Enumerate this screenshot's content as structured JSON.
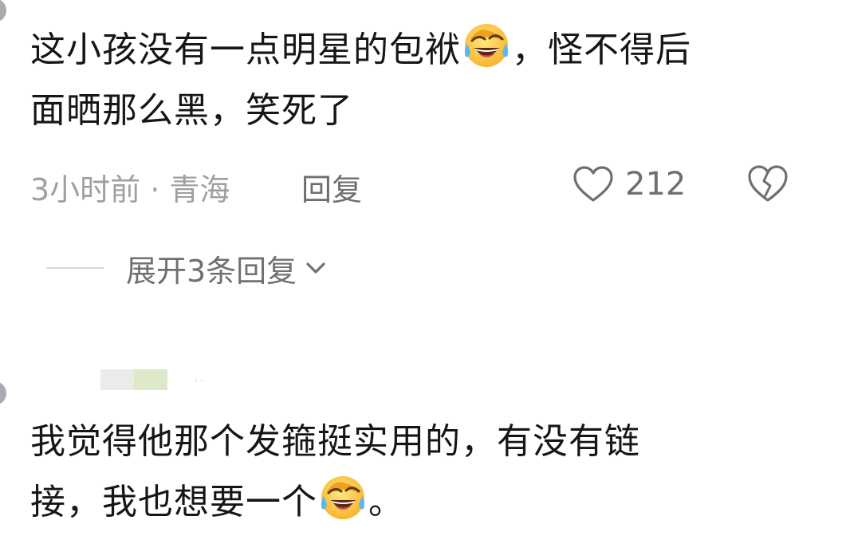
{
  "comment1": {
    "line1_before_emoji": "这小孩没有一点明星的包袱",
    "emoji": "laughing-crying-face-icon",
    "line1_after_emoji": "，怪不得后",
    "line2": "面晒那么黑，笑死了",
    "meta": "3小时前 · 青海",
    "reply_label": "回复",
    "like_count": "212",
    "expand_replies": "展开3条回复"
  },
  "comment2": {
    "line1": "我觉得他那个发箍挺实用的，有没有链",
    "line2_before_emoji": "接，我也想要一个",
    "emoji": "laughing-crying-face-icon",
    "line2_after_emoji": "。"
  },
  "colors": {
    "text": "#161616",
    "meta": "#a0a0a0",
    "secondary": "#6f6f6f",
    "divider": "#d8d8d8"
  }
}
